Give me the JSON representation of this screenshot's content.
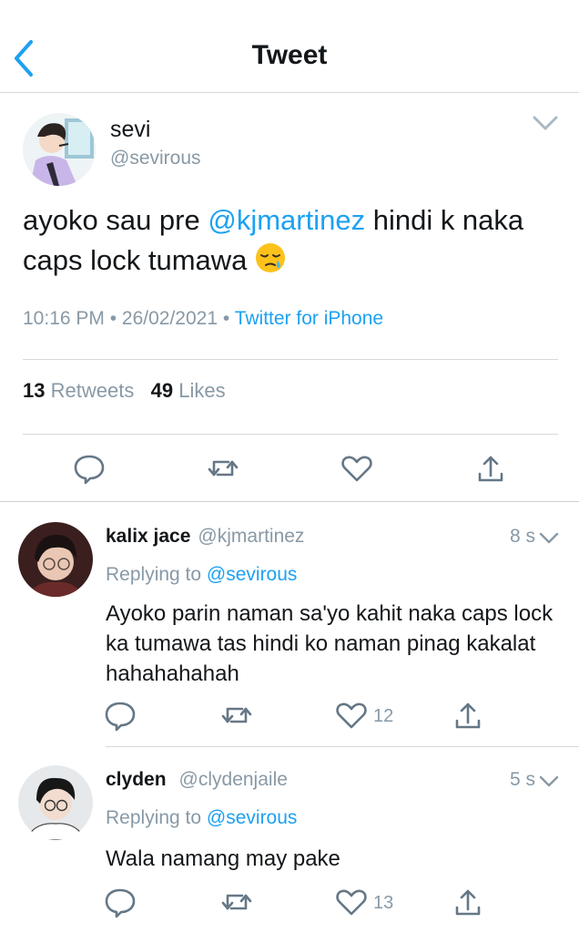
{
  "header": {
    "title": "Tweet"
  },
  "main_tweet": {
    "name": "sevi",
    "handle": "@sevirous",
    "text_before": "ayoko sau pre ",
    "mention": "@kjmartinez",
    "text_after": " hindi k naka caps lock tumawa ",
    "time": "10:16 PM",
    "date": "26/02/2021",
    "source": "Twitter for iPhone",
    "retweets_count": "13",
    "retweets_label": "Retweets",
    "likes_count": "49",
    "likes_label": "Likes"
  },
  "replies": [
    {
      "name": "kalix jace",
      "handle": "@kjmartinez",
      "time": "8 s",
      "replying_label": "Replying to",
      "replying_to": "@sevirous",
      "text": "Ayoko parin naman sa'yo kahit naka caps lock ka tumawa tas hindi ko naman pinag kakalat hahahahahah",
      "likes": "12"
    },
    {
      "name": "clyden",
      "handle": "@clydenjaile",
      "time": "5 s",
      "replying_label": "Replying to",
      "replying_to": "@sevirous",
      "text": "Wala namang may pake",
      "likes": "13"
    }
  ],
  "icons": {
    "back": "chevron-left-icon",
    "more": "chevron-down-icon",
    "reply": "speech-bubble-icon",
    "retweet": "retweet-arrows-icon",
    "like": "heart-icon",
    "share": "share-upload-icon",
    "emoji": "sleepy-face-emoji"
  },
  "colors": {
    "accent": "#1da1f2",
    "text": "#14171a",
    "secondary": "#8899a6",
    "divider": "#d6d9dc"
  }
}
